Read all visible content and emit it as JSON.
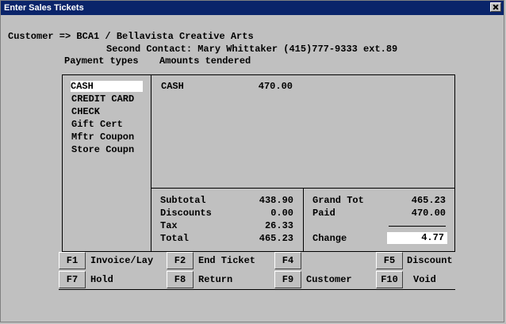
{
  "window": {
    "title": "Enter Sales Tickets"
  },
  "customer": {
    "label": "Customer => BCA1 / Bellavista Creative Arts",
    "contact": "Second Contact: Mary Whittaker (415)777-9333 ext.89"
  },
  "headers": {
    "payment_types": "Payment types",
    "amounts_tendered": "Amounts tendered"
  },
  "payment_types": [
    "CASH",
    "CREDIT CARD",
    "CHECK",
    "Gift Cert",
    "Mftr Coupon",
    "Store Coupn"
  ],
  "tendered": [
    {
      "type": "CASH",
      "amount": "470.00"
    }
  ],
  "totals": {
    "subtotal_label": "Subtotal",
    "subtotal": "438.90",
    "discounts_label": "Discounts",
    "discounts": "0.00",
    "tax_label": "Tax",
    "tax": "26.33",
    "total_label": "Total",
    "total": "465.23",
    "grand_tot_label": "Grand Tot",
    "grand_tot": "465.23",
    "paid_label": "Paid",
    "paid": "470.00",
    "change_label": "Change",
    "change": "4.77"
  },
  "function_keys": [
    {
      "key": "F1",
      "label": "Invoice/Lay"
    },
    {
      "key": "F2",
      "label": "End Ticket"
    },
    {
      "key": "F4",
      "label": ""
    },
    {
      "key": "F5",
      "label": "Discount"
    },
    {
      "key": "F7",
      "label": "Hold"
    },
    {
      "key": "F8",
      "label": "Return"
    },
    {
      "key": "F9",
      "label": "Customer"
    },
    {
      "key": "F10",
      "label": "Void"
    }
  ]
}
